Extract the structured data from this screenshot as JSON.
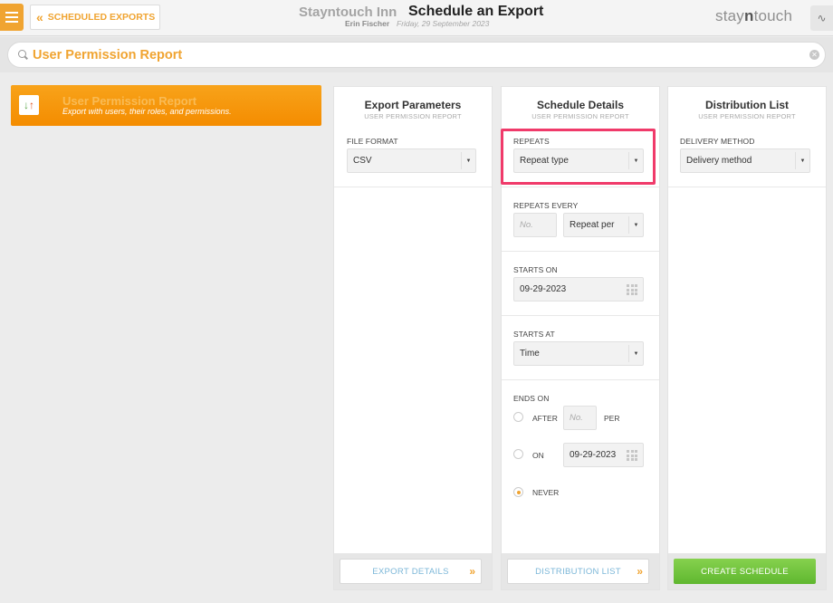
{
  "header": {
    "back_label": "SCHEDULED EXPORTS",
    "hotel_name": "Stayntouch Inn",
    "page_title": "Schedule an Export",
    "user_name": "Erin Fischer",
    "date": "Friday, 29 September 2023",
    "brand_a": "stay",
    "brand_b": "n",
    "brand_c": "touch"
  },
  "search": {
    "value": "User Permission Report"
  },
  "report_card": {
    "title": "User Permission Report",
    "description": "Export with users, their roles, and permissions."
  },
  "export_params": {
    "title": "Export Parameters",
    "subtitle": "USER PERMISSION REPORT",
    "file_format_label": "FILE FORMAT",
    "file_format_value": "CSV",
    "footer_button": "EXPORT DETAILS"
  },
  "schedule": {
    "title": "Schedule Details",
    "subtitle": "USER PERMISSION REPORT",
    "repeats_label": "REPEATS",
    "repeats_value": "Repeat type",
    "repeats_every_label": "REPEATS EVERY",
    "repeats_every_placeholder": "No.",
    "repeat_per_value": "Repeat per",
    "starts_on_label": "STARTS ON",
    "starts_on_value": "09-29-2023",
    "starts_at_label": "STARTS AT",
    "starts_at_value": "Time",
    "ends_on_label": "ENDS ON",
    "after_label": "AFTER",
    "after_placeholder": "No.",
    "per_label": "PER",
    "on_label": "ON",
    "on_date_value": "09-29-2023",
    "never_label": "NEVER",
    "footer_button": "DISTRIBUTION LIST"
  },
  "distribution": {
    "title": "Distribution List",
    "subtitle": "USER PERMISSION REPORT",
    "delivery_label": "DELIVERY METHOD",
    "delivery_value": "Delivery method",
    "footer_button": "CREATE SCHEDULE"
  },
  "colors": {
    "accent": "#f0a431",
    "highlight": "#f03a6a",
    "create": "#6cc23b"
  }
}
